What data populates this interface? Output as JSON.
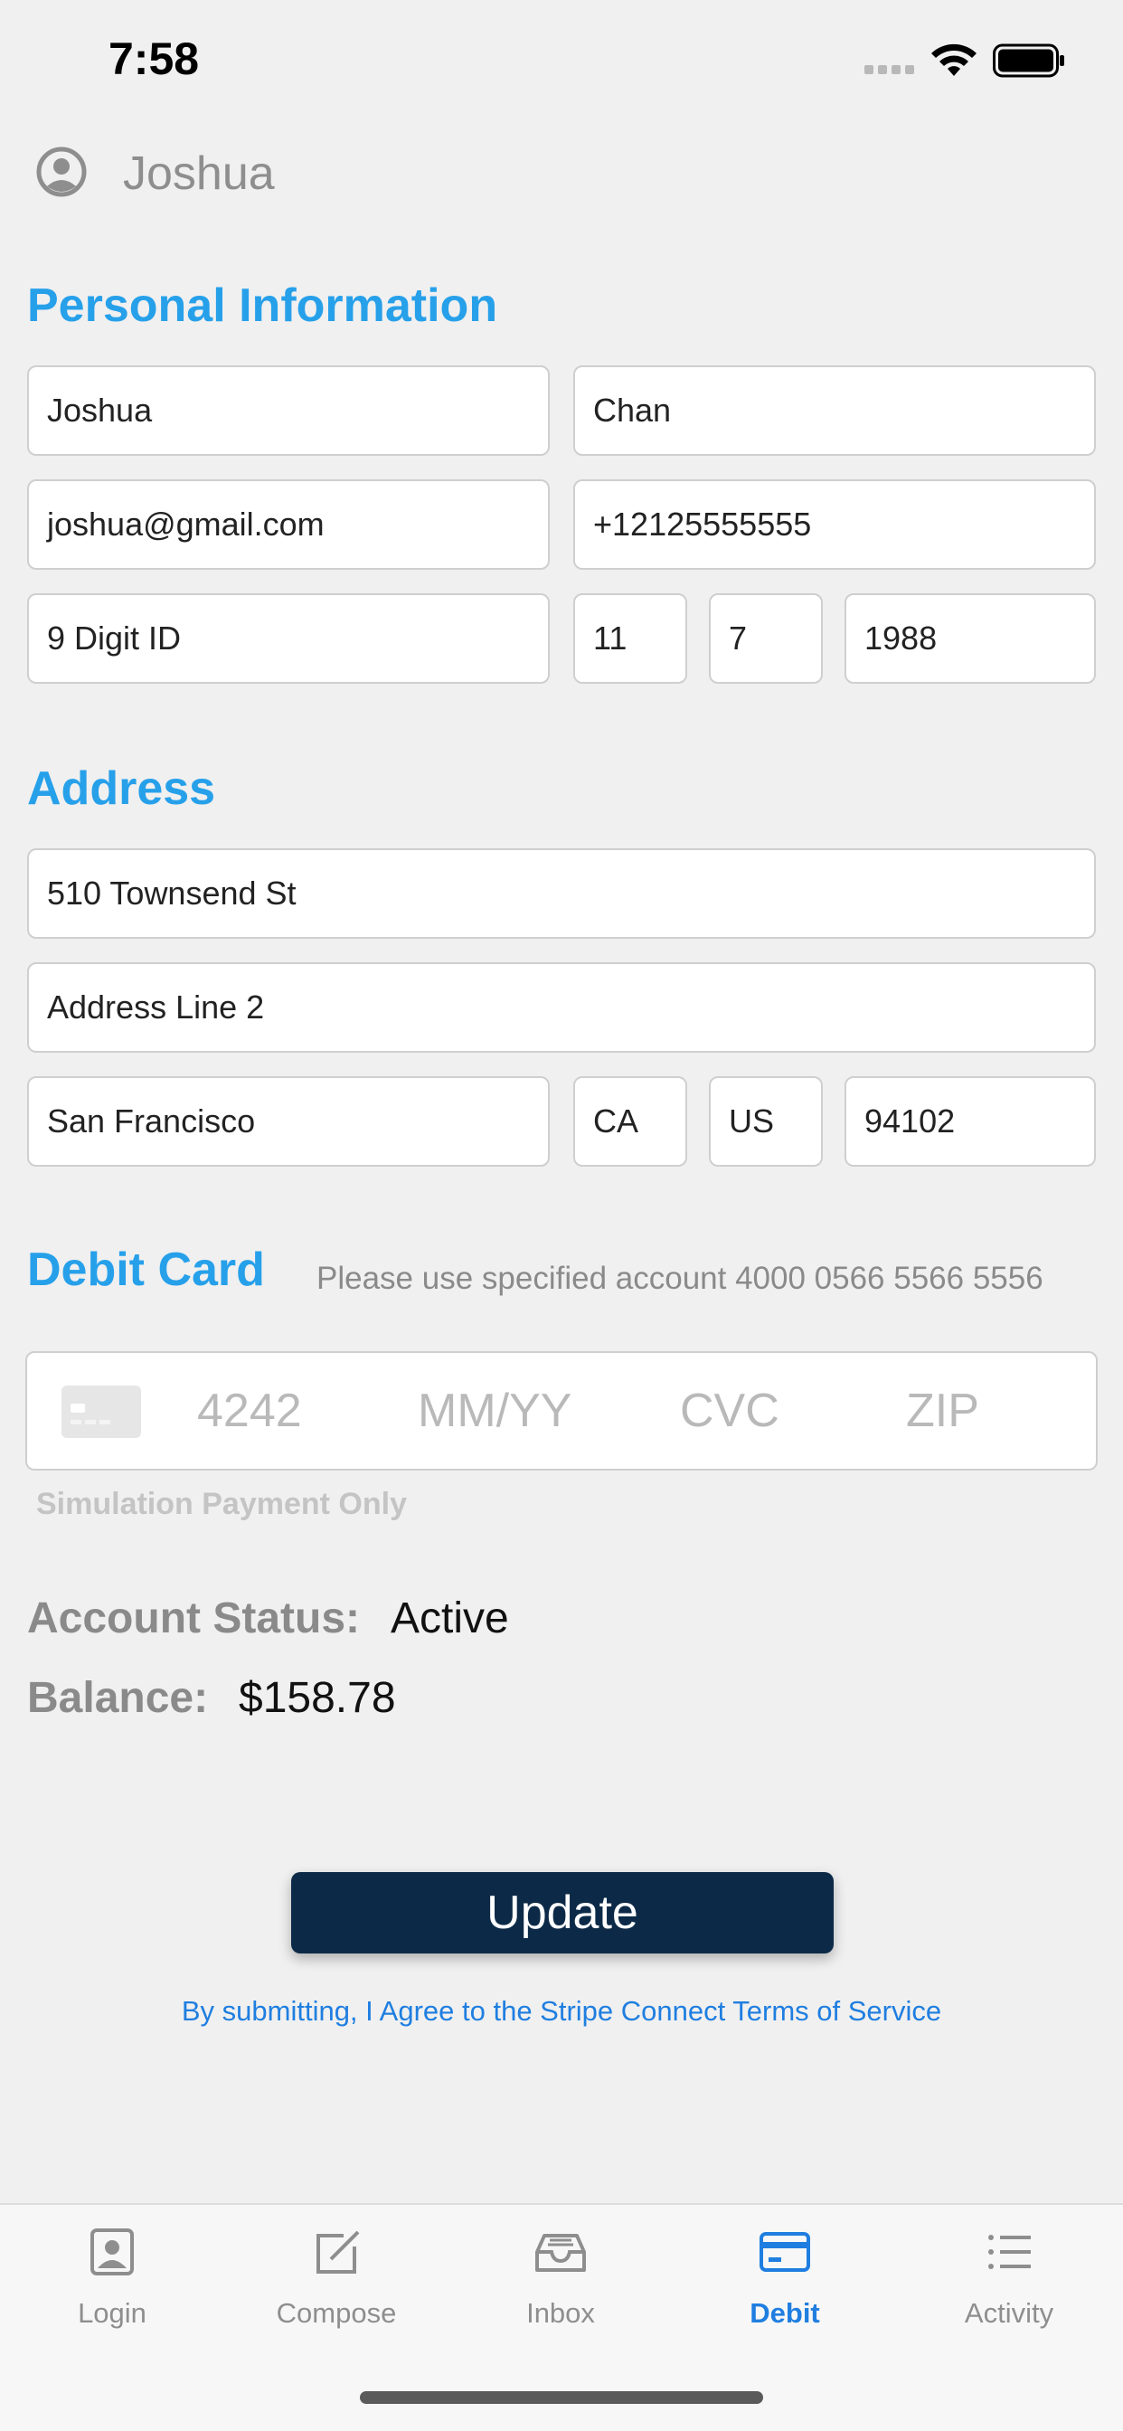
{
  "status_bar": {
    "time": "7:58"
  },
  "user": {
    "name": "Joshua"
  },
  "personal": {
    "title": "Personal Information",
    "first_name": "Joshua",
    "last_name": "Chan",
    "email": "joshua@gmail.com",
    "phone": "+12125555555",
    "id_number": "9 Digit ID",
    "dob_month": "11",
    "dob_day": "7",
    "dob_year": "1988"
  },
  "address": {
    "title": "Address",
    "line1": "510 Townsend St",
    "line2": "Address Line 2",
    "city": "San Francisco",
    "state": "CA",
    "country": "US",
    "zip": "94102"
  },
  "debit": {
    "title": "Debit Card",
    "note": "Please use specified account 4000 0566 5566 5556",
    "card_number_placeholder": "4242",
    "expiry_placeholder": "MM/YY",
    "cvc_placeholder": "CVC",
    "zip_placeholder": "ZIP",
    "simulation_note": "Simulation Payment Only"
  },
  "account": {
    "status_label": "Account Status:",
    "status_value": "Active",
    "balance_label": "Balance:",
    "balance_value": "$158.78"
  },
  "actions": {
    "update_label": "Update",
    "terms_text": "By submitting, I Agree to the Stripe Connect Terms of Service"
  },
  "tabs": [
    {
      "label": "Login",
      "icon": "person-card-icon"
    },
    {
      "label": "Compose",
      "icon": "compose-icon"
    },
    {
      "label": "Inbox",
      "icon": "inbox-tray-icon"
    },
    {
      "label": "Debit",
      "icon": "credit-card-icon",
      "active": true
    },
    {
      "label": "Activity",
      "icon": "list-icon"
    }
  ],
  "colors": {
    "accent": "#27a0ea",
    "button": "#0c2a47",
    "link": "#1f7ee0",
    "background": "#f0f0f0"
  }
}
